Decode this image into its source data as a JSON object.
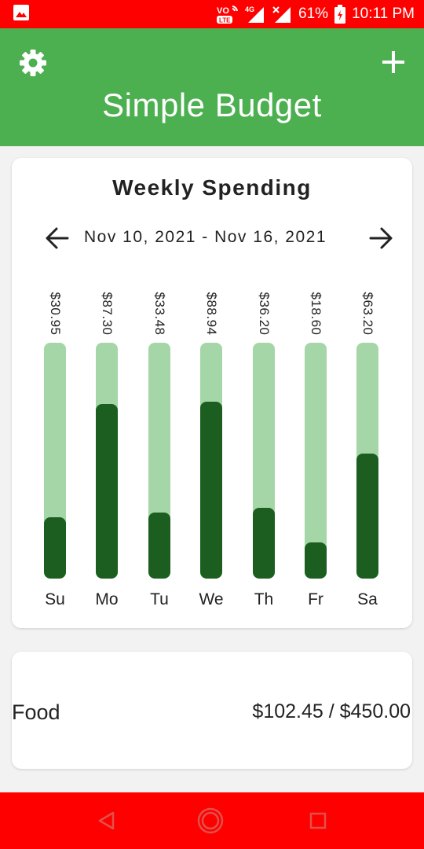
{
  "status_bar": {
    "network_badge": "VoLTE 4G",
    "battery": "61%",
    "time": "10:11 PM",
    "background": "#ff0000"
  },
  "app_bar": {
    "title": "Simple Budget",
    "background": "#4caf50",
    "icons": {
      "left": "gear-icon",
      "right": "plus-icon"
    }
  },
  "weekly": {
    "title": "Weekly Spending",
    "range": "Nov 10, 2021 - Nov 16, 2021",
    "days": [
      {
        "day": "Su",
        "amount": "$30.95",
        "fraction": 0.26
      },
      {
        "day": "Mo",
        "amount": "$87.30",
        "fraction": 0.74
      },
      {
        "day": "Tu",
        "amount": "$33.48",
        "fraction": 0.28
      },
      {
        "day": "We",
        "amount": "$88.94",
        "fraction": 0.75
      },
      {
        "day": "Th",
        "amount": "$36.20",
        "fraction": 0.3
      },
      {
        "day": "Fr",
        "amount": "$18.60",
        "fraction": 0.155
      },
      {
        "day": "Sa",
        "amount": "$63.20",
        "fraction": 0.53
      }
    ],
    "colors": {
      "track": "#a5d6a7",
      "fill": "#1b5e20"
    }
  },
  "categories": [
    {
      "name": "Food",
      "amount": "$102.45 / $450.00"
    }
  ],
  "nav_bar": {
    "buttons": [
      "back-triangle-icon",
      "home-circle-icon",
      "recents-square-icon"
    ],
    "background": "#ff0000"
  }
}
